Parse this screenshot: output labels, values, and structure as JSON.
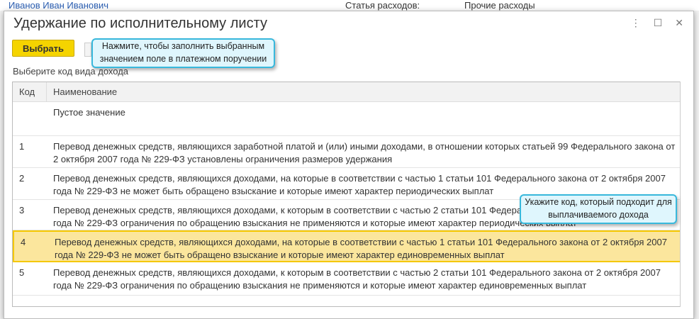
{
  "background": {
    "employee": "Иванов Иван Иванович",
    "field_label": "Статья расходов:",
    "field_value": "Прочие расходы"
  },
  "dialog": {
    "title": "Удержание по исполнительному листу",
    "select_label": "Выбрать",
    "prompt": "Выберите код вида дохода",
    "tip_select": "Нажмите, чтобы заполнить выбранным значением поле в платежном поручении",
    "tip_code": "Укажите код, который подходит для выплачиваемого дохода",
    "columns": [
      "Код",
      "Наименование"
    ],
    "rows": [
      {
        "code": "",
        "name": "Пустое значение"
      },
      {
        "code": "1",
        "name": "Перевод денежных средств, являющихся заработной платой и (или) иными доходами, в отношении которых статьей 99 Федерального закона от 2 октября 2007 года № 229-ФЗ установлены ограничения размеров удержания"
      },
      {
        "code": "2",
        "name": "Перевод денежных средств, являющихся доходами, на которые в соответствии с частью 1 статьи 101 Федерального закона от 2 октября 2007 года № 229-ФЗ не может быть обращено взыскание и которые имеют характер периодических выплат"
      },
      {
        "code": "3",
        "name": "Перевод денежных средств, являющихся доходами, к которым в соответствии с частью 2 статьи 101 Федерального закона от 2 октября 2007 года № 229-ФЗ ограничения по обращению взыскания не применяются и которые имеют характер периодических выплат"
      },
      {
        "code": "4",
        "name": "Перевод денежных средств, являющихся доходами, на которые в соответствии с частью 1 статьи 101 Федерального закона от 2 октября 2007 года № 229-ФЗ не может быть обращено взыскание и которые имеют характер единовременных выплат",
        "selected": true
      },
      {
        "code": "5",
        "name": "Перевод денежных средств, являющихся доходами, к которым в соответствии с частью 2 статьи 101 Федерального закона от 2 октября 2007 года № 229-ФЗ ограничения по обращению взыскания не применяются и которые имеют характер единовременных выплат"
      }
    ]
  },
  "colors": {
    "accent": "#f5d400",
    "selected_row": "#fbe69d",
    "tooltip_border": "#38b8dc"
  }
}
